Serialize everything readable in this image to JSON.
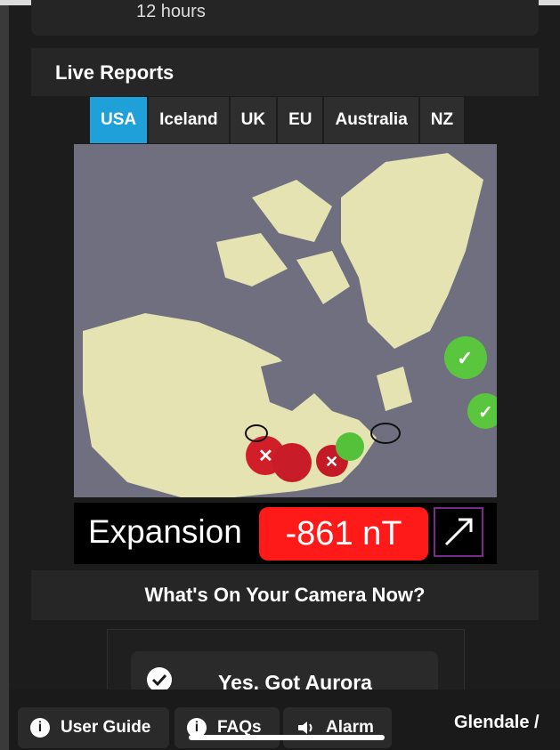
{
  "top_card": {
    "text": "12 hours"
  },
  "live_reports": {
    "title": "Live Reports",
    "tabs": [
      {
        "label": "USA",
        "active": true
      },
      {
        "label": "Iceland",
        "active": false
      },
      {
        "label": "UK",
        "active": false
      },
      {
        "label": "EU",
        "active": false
      },
      {
        "label": "Australia",
        "active": false
      },
      {
        "label": "NZ",
        "active": false
      }
    ]
  },
  "expansion": {
    "label": "Expansion",
    "value": "-861 nT",
    "value_color": "#ff1a1a"
  },
  "camera": {
    "title": "What's On Your Camera Now?",
    "button_label": "Yes, Got Aurora"
  },
  "bottom_nav": {
    "user_guide": "User Guide",
    "faqs": "FAQs",
    "alarm": "Alarm",
    "location": "Glendale /"
  },
  "colors": {
    "accent_tab": "#1fa0d8",
    "land": "#e6e3b3",
    "water": "#6f6f7f"
  }
}
